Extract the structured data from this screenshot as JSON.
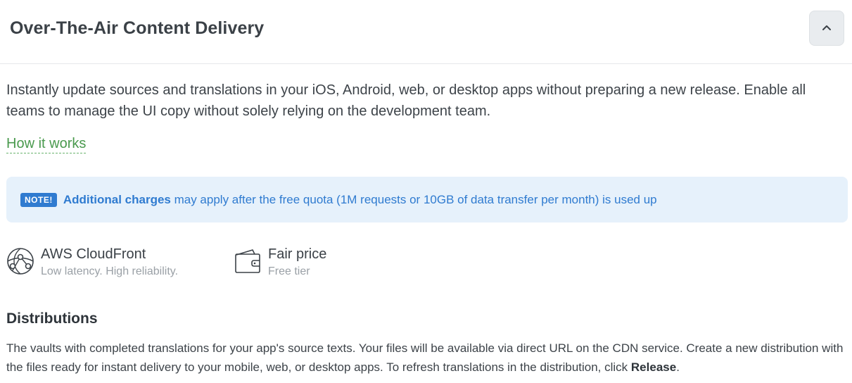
{
  "header": {
    "title": "Over-The-Air Content Delivery",
    "collapse_icon": "chevron-up-icon"
  },
  "intro": {
    "text": "Instantly update sources and translations in your iOS, Android, web, or desktop apps without preparing a new release. Enable all teams to manage the UI copy without solely relying on the development team.",
    "how_it_works_label": "How it works"
  },
  "note": {
    "badge": "NOTE!",
    "link_text": "Additional charges",
    "text": " may apply after the free quota (1M requests or 10GB of data transfer per month) is used up",
    "bg_color": "#e6f1fb",
    "accent_color": "#2f7bd0"
  },
  "features": [
    {
      "icon": "globe-network-icon",
      "title": "AWS CloudFront",
      "subtitle": "Low latency. High reliability."
    },
    {
      "icon": "wallet-icon",
      "title": "Fair price",
      "subtitle": "Free tier"
    }
  ],
  "distributions": {
    "title": "Distributions",
    "description_prefix": "The vaults with completed translations for your app's source texts. Your files will be available via direct URL on the CDN service. Create a new distribution with the files ready for instant delivery to your mobile, web, or desktop apps. To refresh translations in the distribution, click ",
    "release_label": "Release",
    "description_suffix": "."
  },
  "colors": {
    "link_green": "#4a9a4e",
    "text": "#3d4349"
  }
}
